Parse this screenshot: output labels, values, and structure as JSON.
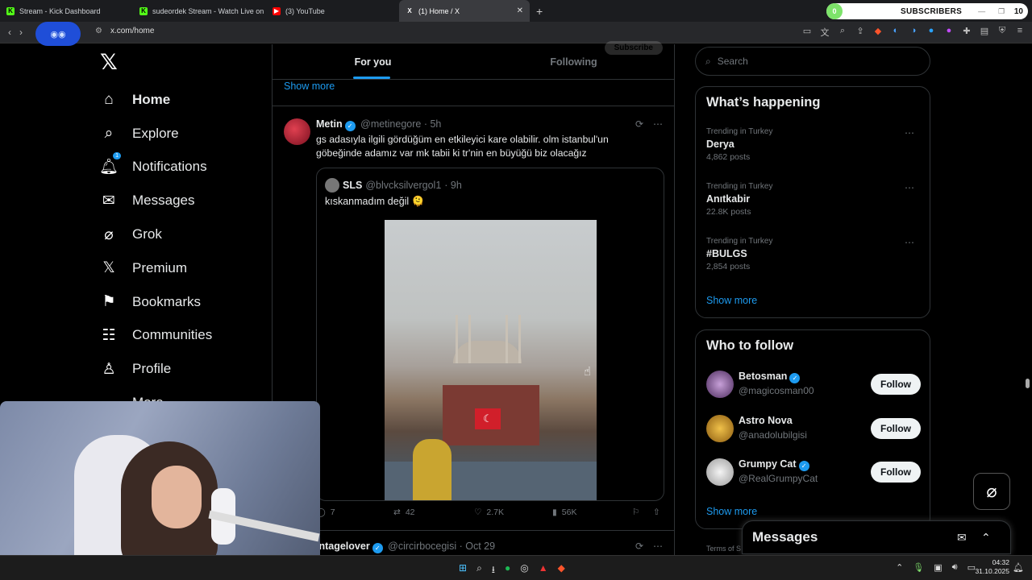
{
  "browser": {
    "tabs": [
      {
        "title": "Stream - Kick Dashboard",
        "icon": "kick-icon"
      },
      {
        "title": "sudeordek Stream - Watch Live on Ki",
        "icon": "kick-icon"
      },
      {
        "title": "(3) YouTube",
        "icon": "youtube-icon"
      },
      {
        "title": "(1) Home / X",
        "icon": "x-icon"
      }
    ],
    "active_tab": 3,
    "url": "x.com/home",
    "subs_widget": {
      "count_left": "0",
      "label": "SUBSCRIBERS",
      "count_right": "10"
    }
  },
  "nav": {
    "items": [
      {
        "label": "Home",
        "icon": "home-icon",
        "glyph": "⌂"
      },
      {
        "label": "Explore",
        "icon": "search-icon",
        "glyph": "⌕"
      },
      {
        "label": "Notifications",
        "icon": "bell-icon",
        "glyph": "♫",
        "badge": "1"
      },
      {
        "label": "Messages",
        "icon": "mail-icon",
        "glyph": "✉"
      },
      {
        "label": "Grok",
        "icon": "grok-icon",
        "glyph": "⌀"
      },
      {
        "label": "Premium",
        "icon": "x-premium-icon",
        "glyph": "X"
      },
      {
        "label": "Bookmarks",
        "icon": "bookmark-icon",
        "glyph": "⚑"
      },
      {
        "label": "Communities",
        "icon": "communities-icon",
        "glyph": "☷"
      },
      {
        "label": "Profile",
        "icon": "profile-icon",
        "glyph": "♙"
      },
      {
        "label": "More",
        "icon": "more-icon",
        "glyph": "…"
      }
    ]
  },
  "feed": {
    "tabs": [
      "For you",
      "Following"
    ],
    "active_tab": "For you",
    "subscribe_label": "Subscribe",
    "show_more": "Show more",
    "post": {
      "name": "Metin",
      "handle": "@metinegore",
      "time": "· 5h",
      "text": "gs adasıyla ilgili gördüğüm en etkileyici kare olabilir. olm istanbul'un göbeğinde adamız var mk tabii ki tr'nin en büyüğü biz olacağız",
      "quote": {
        "name": "SLS",
        "handle": "@blvcksilvergol1",
        "time": "· 9h",
        "text": "kıskanmadım değil 🫠"
      },
      "replies": "7",
      "reposts": "42",
      "likes": "2.7K",
      "views": "56K"
    },
    "post2": {
      "name": "intagelover",
      "handle": "@circirbocegisi",
      "time": "· Oct 29"
    }
  },
  "right": {
    "search_placeholder": "Search",
    "happening_title": "What’s happening",
    "trends": [
      {
        "context": "Trending in Turkey",
        "name": "Derya",
        "count": "4,862 posts"
      },
      {
        "context": "Trending in Turkey",
        "name": "Anıtkabir",
        "count": "22.8K posts"
      },
      {
        "context": "Trending in Turkey",
        "name": "#BULGS",
        "count": "2,854 posts"
      }
    ],
    "show_more": "Show more",
    "who_title": "Who to follow",
    "follows": [
      {
        "name": "Betosman",
        "handle": "@magicosman00",
        "button": "Follow",
        "verified": true
      },
      {
        "name": "Astro Nova",
        "handle": "@anadolubilgisi",
        "button": "Follow",
        "verified": false
      },
      {
        "name": "Grumpy Cat",
        "handle": "@RealGrumpyCat",
        "button": "Follow",
        "verified": true
      }
    ],
    "terms": "Terms of S",
    "messages_title": "Messages"
  },
  "taskbar": {
    "time": "04:32",
    "date": "31.10.2025"
  },
  "colors": {
    "accent": "#1d9bf0",
    "background": "#000000",
    "border": "#2f3336"
  }
}
